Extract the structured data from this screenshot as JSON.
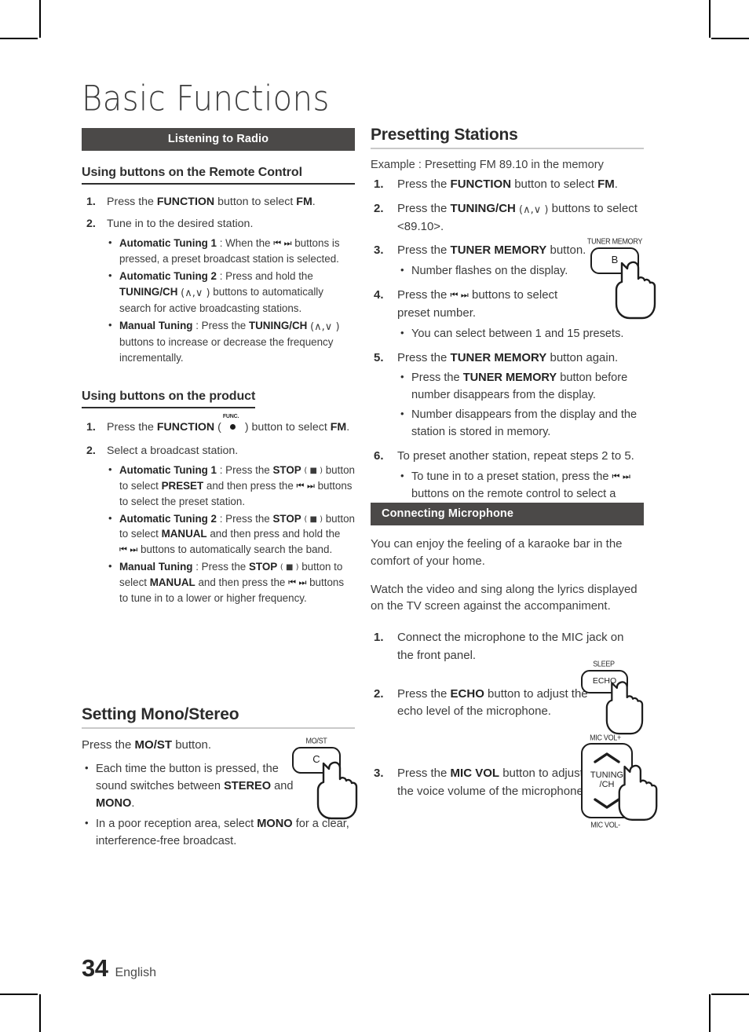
{
  "page": {
    "title": "Basic Functions",
    "folio_number": "34",
    "folio_language": "English"
  },
  "left_column": {
    "section_bar": "Listening to Radio",
    "remote_heading": "Using buttons on the Remote Control",
    "remote_steps": [
      {
        "num": "1.",
        "text_pre": "Press the ",
        "bold1": "FUNCTION",
        "text_mid": " button to select ",
        "bold2": "FM",
        "text_post": "."
      },
      {
        "num": "2.",
        "text": "Tune in to the desired station."
      }
    ],
    "remote_bullets": [
      {
        "label": "Automatic Tuning 1",
        "sep": " : ",
        "body_a": "When the ",
        "glyph": "prev-next-icons",
        "body_b": " buttons is pressed, a preset broadcast station is selected."
      },
      {
        "label": "Automatic Tuning 2",
        "sep": " : ",
        "body_a": "Press and hold the ",
        "bold_inline": "TUNING/CH",
        "paren": "(∧,∨ )",
        "body_b": " buttons to automatically search for active broadcasting stations."
      },
      {
        "label": "Manual Tuning",
        "sep": " : ",
        "body_a": "Press the ",
        "bold_inline": "TUNING/CH",
        "paren": "(∧,∨ )",
        "body_b": " buttons to increase or decrease the frequency incrementally."
      }
    ],
    "product_heading": "Using buttons on the product",
    "product_step1": {
      "num": "1.",
      "pre": "Press the ",
      "bold1": "FUNCTION",
      "icon_label": "FUNC.",
      "mid": " button to select ",
      "bold2": "FM",
      "post": "."
    },
    "product_step2": {
      "num": "2.",
      "text": "Select a broadcast station."
    },
    "product_bullets": [
      {
        "label": "Automatic Tuning 1",
        "sep": " : ",
        "a": "Press the ",
        "stop": "STOP",
        "b": " button to select ",
        "preset": "PRESET",
        "c": " and then press the ",
        "d": " buttons to select the preset station."
      },
      {
        "label": "Automatic Tuning 2",
        "sep": " : ",
        "a": "Press the ",
        "stop": "STOP",
        "b": " button to select ",
        "preset": "MANUAL",
        "c": " and then press and hold the ",
        "d": " buttons to automatically search the band."
      },
      {
        "label": "Manual Tuning",
        "sep": " : ",
        "a": "Press the ",
        "stop": "STOP",
        "b": " button to select ",
        "preset": "MANUAL",
        "c": " and then press the ",
        "d": " buttons to tune in to a lower or higher frequency."
      }
    ],
    "mono_heading": "Setting Mono/Stereo",
    "mono_intro_a": "Press the ",
    "mono_intro_b": "MO/ST",
    "mono_intro_c": " button.",
    "mono_bullets": [
      {
        "a": "Each time the button is pressed, the sound switches between ",
        "b1": "STEREO",
        "mid": " and ",
        "b2": "MONO",
        "c": "."
      },
      {
        "a": "In a poor reception area, select ",
        "b1": "MONO",
        "mid": "",
        "b2": "",
        "c": " for a clear, interference-free broadcast."
      }
    ],
    "mono_button_illus": {
      "caption": "MO/ST",
      "key_label": "C"
    }
  },
  "right_column": {
    "presetting_heading": "Presetting Stations",
    "example_line": "Example : Presetting FM 89.10 in the memory",
    "presetting_steps": [
      {
        "num": "1.",
        "a": "Press the ",
        "b": "FUNCTION",
        "c": " button to select ",
        "d": "FM",
        "e": "."
      },
      {
        "num": "2.",
        "a": "Press the ",
        "b": "TUNING/CH",
        "paren": "(∧,∨ )",
        "c": " buttons to select <89.10>."
      },
      {
        "num": "3.",
        "a": "Press the ",
        "b": "TUNER MEMORY",
        "c": " button."
      },
      {
        "num": "4.",
        "a": "Press the ",
        "glyph": "prev-next-icons",
        "c": " buttons to select preset number."
      },
      {
        "num": "5.",
        "a": "Press the ",
        "b": "TUNER MEMORY",
        "c": " button again."
      },
      {
        "num": "6.",
        "a": "To preset another station, repeat steps 2 to 5."
      }
    ],
    "step3_bullet": "Number flashes on the display.",
    "step4_bullet": "You can select between 1 and 15 presets.",
    "step5_bullets": [
      {
        "a": "Press the ",
        "b": "TUNER MEMORY",
        "c": " button before number disappears from the display."
      },
      {
        "a": "Number disappears from the display and the station is stored in memory.",
        "b": "",
        "c": ""
      }
    ],
    "step6_bullet": {
      "a": "To tune in to a preset station, press the ",
      "c": " buttons on the remote control to select a channel."
    },
    "tuner_memory_illus": {
      "caption": "TUNER MEMORY",
      "key_label": "B"
    },
    "mic_section_bar": "Connecting Microphone",
    "mic_para1": "You can enjoy the feeling of a karaoke bar in the comfort of your home.",
    "mic_para2": "Watch the video and sing along the lyrics displayed on the TV screen against the accompaniment.",
    "mic_steps": [
      {
        "num": "1.",
        "a": "Connect the microphone to the MIC jack on the front panel.",
        "b": "",
        "c": ""
      },
      {
        "num": "2.",
        "a": "Press the ",
        "b": "ECHO",
        "c": " button to adjust the echo level of the microphone."
      },
      {
        "num": "3.",
        "a": "Press the ",
        "b": "MIC VOL",
        "c": " button to adjust the voice volume of the microphone."
      }
    ],
    "echo_illus": {
      "caption_top": "SLEEP",
      "key_label": "ECHO"
    },
    "mic_vol_illus": {
      "caption_top": "MIC VOL+",
      "caption_bottom": "MIC VOL-",
      "key_label_1": "TUNING",
      "key_label_2": "/CH"
    }
  },
  "colors": {
    "section_bar_bg": "#4b4948",
    "body_text": "#3b3b3b",
    "rule_gray": "#c9c9c9"
  }
}
